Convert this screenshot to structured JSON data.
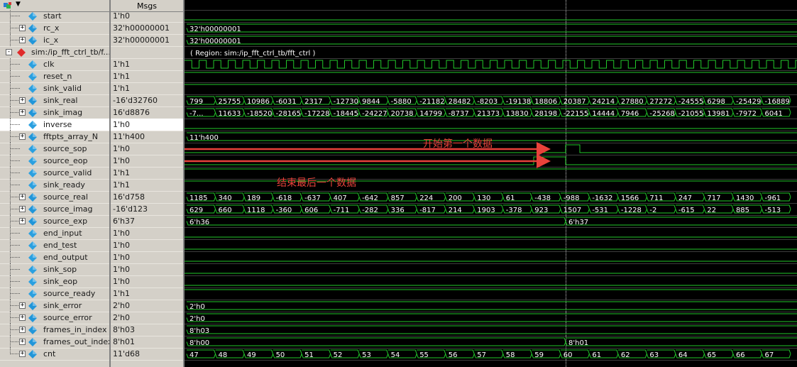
{
  "header": {
    "names_title": "",
    "values_title": "Msgs"
  },
  "colors": {
    "wave": "#22c92a",
    "bus_text": "#ffffff",
    "grid": "#3d3d3d",
    "arrow": "#e8423a",
    "cursor": "#d0d0d0"
  },
  "signals": [
    {
      "name": "start",
      "value": "1'h0",
      "expand": "",
      "type": "bit",
      "level": 0
    },
    {
      "name": "rc_x",
      "value": "32'h00000001",
      "expand": "+",
      "type": "bus",
      "segments": [
        "32'h00000001"
      ]
    },
    {
      "name": "ic_x",
      "value": "32'h00000001",
      "expand": "+",
      "type": "bus",
      "segments": [
        "32'h00000001"
      ]
    },
    {
      "name": "sim:/ip_fft_ctrl_tb/f...",
      "value": "",
      "expand": "-",
      "type": "region",
      "region": "( Region: sim:/ip_fft_ctrl_tb/fft_ctrl )"
    },
    {
      "name": "clk",
      "value": "1'h1",
      "expand": "",
      "type": "clk"
    },
    {
      "name": "reset_n",
      "value": "1'h1",
      "expand": "",
      "type": "bit",
      "level": 1
    },
    {
      "name": "sink_valid",
      "value": "1'h1",
      "expand": "",
      "type": "bit",
      "level": 1
    },
    {
      "name": "sink_real",
      "value": "-16'd32760",
      "expand": "+",
      "type": "bus",
      "segments": [
        "799",
        "25755",
        "10986",
        "-6031",
        "2317",
        "-12730",
        "9844",
        "-5880",
        "-21182",
        "28482",
        "-8203",
        "-19138",
        "18806",
        "20387",
        "24214",
        "27880",
        "27272",
        "-24555",
        "6298",
        "-25429",
        "-16889"
      ]
    },
    {
      "name": "sink_imag",
      "value": "16'd8876",
      "expand": "+",
      "type": "bus",
      "segments": [
        "-7...",
        "11633",
        "-18520",
        "-28165",
        "-17228",
        "-18445",
        "-24227",
        "20738",
        "14799",
        "-8737",
        "21373",
        "13830",
        "28198",
        "-22155",
        "14444",
        "7946",
        "-25268",
        "-21055",
        "13981",
        "-7972",
        "6041"
      ]
    },
    {
      "name": "inverse",
      "value": "1'h0",
      "expand": "",
      "type": "bit",
      "level": 0,
      "selected": true
    },
    {
      "name": "fftpts_array_N",
      "value": "11'h400",
      "expand": "+",
      "type": "bus",
      "segments": [
        "11'h400"
      ]
    },
    {
      "name": "source_sop",
      "value": "1'h0",
      "expand": "",
      "type": "sop"
    },
    {
      "name": "source_eop",
      "value": "1'h0",
      "expand": "",
      "type": "eop"
    },
    {
      "name": "source_valid",
      "value": "1'h1",
      "expand": "",
      "type": "bit",
      "level": 1
    },
    {
      "name": "sink_ready",
      "value": "1'h1",
      "expand": "",
      "type": "bit",
      "level": 1
    },
    {
      "name": "source_real",
      "value": "16'd758",
      "expand": "+",
      "type": "bus",
      "segments": [
        "1185",
        "340",
        "189",
        "-618",
        "-637",
        "407",
        "-642",
        "857",
        "224",
        "200",
        "130",
        "61",
        "-438",
        "-988",
        "-1632",
        "1566",
        "711",
        "247",
        "717",
        "1430",
        "-961"
      ]
    },
    {
      "name": "source_imag",
      "value": "-16'd123",
      "expand": "+",
      "type": "bus",
      "segments": [
        "629",
        "660",
        "1118",
        "-360",
        "606",
        "-711",
        "-282",
        "336",
        "-817",
        "214",
        "1903",
        "-378",
        "923",
        "1507",
        "-531",
        "-1228",
        "-2",
        "-615",
        "22",
        "885",
        "-513"
      ]
    },
    {
      "name": "source_exp",
      "value": "6'h37",
      "expand": "+",
      "type": "bus2",
      "segments": [
        "6'h36",
        "6'h37"
      ]
    },
    {
      "name": "end_input",
      "value": "1'h0",
      "expand": "",
      "type": "bit",
      "level": 0
    },
    {
      "name": "end_test",
      "value": "1'h0",
      "expand": "",
      "type": "bit",
      "level": 0
    },
    {
      "name": "end_output",
      "value": "1'h0",
      "expand": "",
      "type": "bit",
      "level": 0
    },
    {
      "name": "sink_sop",
      "value": "1'h0",
      "expand": "",
      "type": "bit",
      "level": 0
    },
    {
      "name": "sink_eop",
      "value": "1'h0",
      "expand": "",
      "type": "bit",
      "level": 0
    },
    {
      "name": "source_ready",
      "value": "1'h1",
      "expand": "",
      "type": "bit",
      "level": 1
    },
    {
      "name": "sink_error",
      "value": "2'h0",
      "expand": "+",
      "type": "bus",
      "segments": [
        "2'h0"
      ]
    },
    {
      "name": "source_error",
      "value": "2'h0",
      "expand": "+",
      "type": "bus",
      "segments": [
        "2'h0"
      ]
    },
    {
      "name": "frames_in_index",
      "value": "8'h03",
      "expand": "+",
      "type": "bus",
      "segments": [
        "8'h03"
      ]
    },
    {
      "name": "frames_out_index",
      "value": "8'h01",
      "expand": "+",
      "type": "bus2",
      "segments": [
        "8'h00",
        "8'h01"
      ]
    },
    {
      "name": "cnt",
      "value": "11'd68",
      "expand": "+",
      "type": "bus",
      "segments": [
        "47",
        "48",
        "49",
        "50",
        "51",
        "52",
        "53",
        "54",
        "55",
        "56",
        "57",
        "58",
        "59",
        "60",
        "61",
        "62",
        "63",
        "64",
        "65",
        "66",
        "67"
      ]
    }
  ],
  "annotations": {
    "sop_text": "开始第一个数据",
    "eop_text": "结束最后一个数据"
  }
}
